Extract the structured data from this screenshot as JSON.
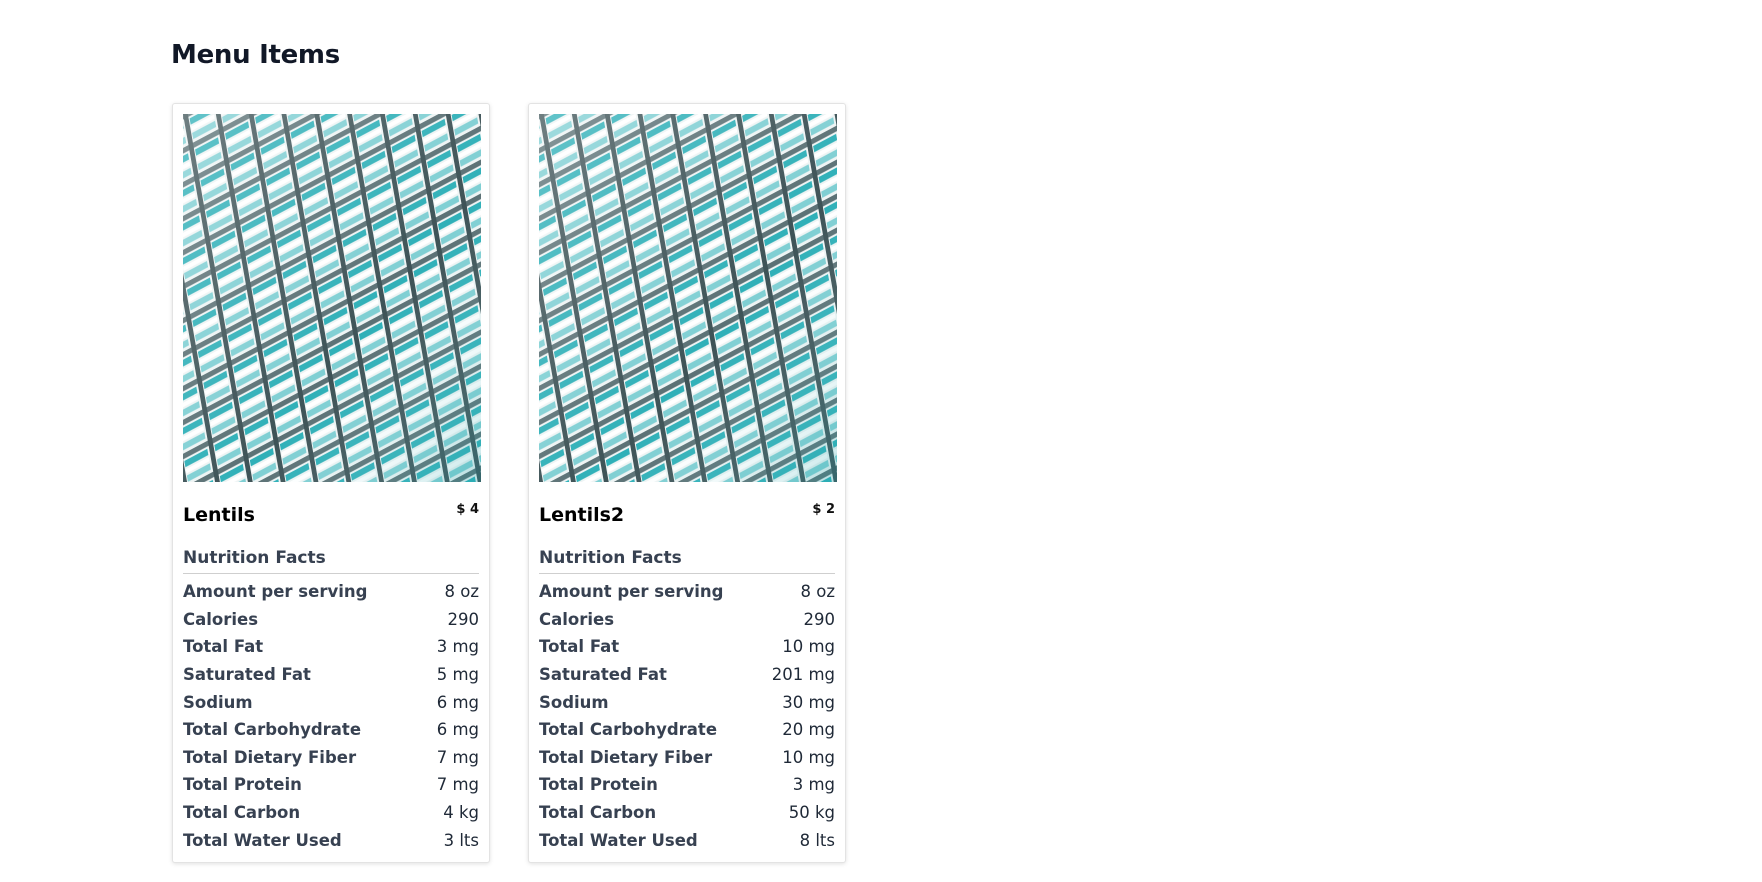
{
  "page": {
    "title": "Menu Items"
  },
  "colors": {
    "image_teal": "#2aa5ad",
    "image_dark": "#4b5f63",
    "image_light": "#f1f5f5"
  },
  "items": [
    {
      "name": "Lentils",
      "price": "$ 4",
      "image_icon": "architecture-photo",
      "nutrition_title": "Nutrition Facts",
      "rows": [
        {
          "label": "Amount per serving",
          "value": "8 oz"
        },
        {
          "label": "Calories",
          "value": "290"
        },
        {
          "label": "Total Fat",
          "value": "3 mg"
        },
        {
          "label": "Saturated Fat",
          "value": "5 mg"
        },
        {
          "label": "Sodium",
          "value": "6 mg"
        },
        {
          "label": "Total Carbohydrate",
          "value": "6 mg"
        },
        {
          "label": "Total Dietary Fiber",
          "value": "7 mg"
        },
        {
          "label": "Total Protein",
          "value": "7 mg"
        },
        {
          "label": "Total Carbon",
          "value": "4 kg"
        },
        {
          "label": "Total Water Used",
          "value": "3 lts"
        }
      ]
    },
    {
      "name": "Lentils2",
      "price": "$ 2",
      "image_icon": "architecture-photo",
      "nutrition_title": "Nutrition Facts",
      "rows": [
        {
          "label": "Amount per serving",
          "value": "8 oz"
        },
        {
          "label": "Calories",
          "value": "290"
        },
        {
          "label": "Total Fat",
          "value": "10 mg"
        },
        {
          "label": "Saturated Fat",
          "value": "201 mg"
        },
        {
          "label": "Sodium",
          "value": "30 mg"
        },
        {
          "label": "Total Carbohydrate",
          "value": "20 mg"
        },
        {
          "label": "Total Dietary Fiber",
          "value": "10 mg"
        },
        {
          "label": "Total Protein",
          "value": "3 mg"
        },
        {
          "label": "Total Carbon",
          "value": "50 kg"
        },
        {
          "label": "Total Water Used",
          "value": "8 lts"
        }
      ]
    }
  ]
}
